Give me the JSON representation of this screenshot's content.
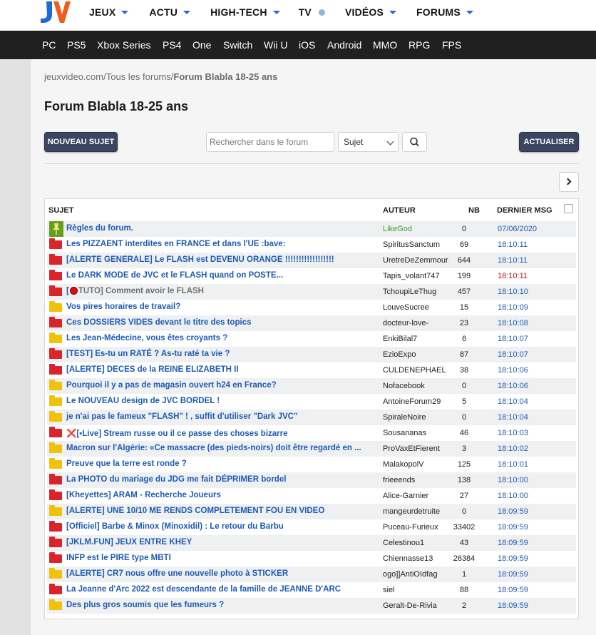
{
  "header": {
    "nav": [
      {
        "label": "JEUX",
        "marker": "caret"
      },
      {
        "label": "ACTU",
        "marker": "caret"
      },
      {
        "label": "HIGH-TECH",
        "marker": "caret"
      },
      {
        "label": "TV",
        "marker": "dot"
      },
      {
        "label": "VIDÉOS",
        "marker": "caret"
      },
      {
        "label": "FORUMS",
        "marker": "caret"
      }
    ]
  },
  "platforms": [
    "PC",
    "PS5",
    "Xbox Series",
    "PS4",
    "One",
    "Switch",
    "Wii U",
    "iOS",
    "Android",
    "MMO",
    "RPG",
    "FPS"
  ],
  "breadcrumb": {
    "site": "jeuxvideo.com",
    "sep1": "/",
    "forums": "Tous les forums",
    "sep2": "/",
    "current": "Forum Blabla 18-25 ans"
  },
  "page_title": "Forum Blabla 18-25 ans",
  "toolbar": {
    "new_topic": "NOUVEAU SUJET",
    "search_placeholder": "Rechercher dans le forum",
    "search_scope": "Sujet",
    "refresh": "ACTUALISER"
  },
  "table": {
    "headers": {
      "subject": "SUJET",
      "author": "AUTEUR",
      "count": "NB",
      "last": "DERNIER MSG"
    },
    "rows": [
      {
        "icon": "pin",
        "subject": "Règles du forum.",
        "author": "LikeGod",
        "author_color": "green",
        "nb": "0",
        "last": "07/06/2020",
        "last_color": "blue"
      },
      {
        "icon": "red",
        "subject": "Les PIZZAENT interdites en FRANCE et dans l'UE :bave:",
        "author": "SpiritusSanctum",
        "nb": "69",
        "last": "18:10:11",
        "last_color": "blue"
      },
      {
        "icon": "red",
        "subject": "[ALERTE GENERALE] Le FLASH est DEVENU ORANGE !!!!!!!!!!!!!!!!!!",
        "author": "UretreDeZemmour",
        "nb": "644",
        "last": "18:10:11",
        "last_color": "blue"
      },
      {
        "icon": "red",
        "subject": "Le DARK MODE de JVC et le FLASH quand on POSTE...",
        "author": "Tapis_volant747",
        "nb": "199",
        "last": "18:10:11",
        "last_color": "red"
      },
      {
        "icon": "red",
        "subject_prefix": "[",
        "subject": "TUTO] Comment avoir le FLASH",
        "dim": true,
        "dot": true,
        "author": "TchoupiLeThug",
        "nb": "457",
        "last": "18:10:10",
        "last_color": "blue"
      },
      {
        "icon": "yellow",
        "subject": "Vos pires horaires de travail?",
        "author": "LouveSucree",
        "nb": "15",
        "last": "18:10:09",
        "last_color": "blue"
      },
      {
        "icon": "red",
        "subject": "Ces DOSSIERS VIDES devant le titre des topics",
        "author": "docteur-love-",
        "nb": "23",
        "last": "18:10:08",
        "last_color": "blue"
      },
      {
        "icon": "yellow",
        "subject": "Les Jean-Médecine, vous êtes croyants ?",
        "author": "EnkiBilal7",
        "nb": "6",
        "last": "18:10:07",
        "last_color": "blue"
      },
      {
        "icon": "red",
        "subject": "[TEST] Es-tu un RATÉ ? As-tu raté ta vie ?",
        "author": "EzioExpo",
        "nb": "87",
        "last": "18:10:07",
        "last_color": "blue"
      },
      {
        "icon": "red",
        "subject": "[ALERTE] DECES de la REINE ELIZABETH II",
        "author": "CULDENEPHAEL",
        "nb": "38",
        "last": "18:10:06",
        "last_color": "blue"
      },
      {
        "icon": "yellow",
        "subject": "Pourquoi il y a pas de magasin ouvert h24 en France?",
        "author": "Nofacebook",
        "nb": "0",
        "last": "18:10:06",
        "last_color": "blue"
      },
      {
        "icon": "yellow",
        "subject": "Le NOUVEAU design de JVC BORDEL !",
        "author": "AntoineForum29",
        "nb": "5",
        "last": "18:10:04",
        "last_color": "blue"
      },
      {
        "icon": "yellow",
        "subject": "je n'ai pas le fameux \"FLASH\" ! , suffit d'utiliser \"Dark JVC\"",
        "author": "SpiraleNoire",
        "nb": "0",
        "last": "18:10:04",
        "last_color": "blue"
      },
      {
        "icon": "red",
        "subject_prefix": "❌",
        "subject": "[▪Live] Stream russe ou il ce passe des choses bizarre",
        "author": "Sousananas",
        "nb": "46",
        "last": "18:10:03",
        "last_color": "blue"
      },
      {
        "icon": "yellow",
        "subject": "Macron sur l'Algérie: «Ce massacre (des pieds-noirs) doit être regardé en ...",
        "author": "ProVaxEtFierent",
        "nb": "3",
        "last": "18:10:02",
        "last_color": "blue"
      },
      {
        "icon": "yellow",
        "subject": "Preuve que la terre est ronde ?",
        "author": "MalakopolV",
        "nb": "125",
        "last": "18:10:01",
        "last_color": "blue"
      },
      {
        "icon": "red",
        "subject": "La PHOTO du mariage du JDG me fait DÉPRIMER bordel",
        "author": "frieeends",
        "nb": "138",
        "last": "18:10:00",
        "last_color": "blue"
      },
      {
        "icon": "red",
        "subject": "[Kheyettes] ARAM - Recherche Joueurs",
        "author": "Alice-Garnier",
        "nb": "27",
        "last": "18:10:00",
        "last_color": "blue"
      },
      {
        "icon": "yellow",
        "subject": "[ALERTE] UNE 10/10 ME RENDS COMPLETEMENT FOU EN VIDEO",
        "author": "mangeurdetruite",
        "nb": "0",
        "last": "18:09:59",
        "last_color": "blue"
      },
      {
        "icon": "red",
        "subject": "[Officiel] Barbe & Minox (Minoxidil) : Le retour du Barbu",
        "author": "Puceau-Furieux",
        "nb": "33402",
        "last": "18:09:59",
        "last_color": "blue"
      },
      {
        "icon": "red",
        "subject": "[JKLM.FUN] JEUX ENTRE KHEY",
        "author": "Celestinou1",
        "nb": "43",
        "last": "18:09:59",
        "last_color": "blue"
      },
      {
        "icon": "red",
        "subject": "INFP est le PIRE type MBTI",
        "author": "Chiennasse13",
        "nb": "26384",
        "last": "18:09:59",
        "last_color": "blue"
      },
      {
        "icon": "yellow",
        "subject": "[ALERTE] CR7 nous offre une nouvelle photo à STICKER",
        "author": "ogo]]AntiOIdfag",
        "nb": "1",
        "last": "18:09:59",
        "last_color": "blue"
      },
      {
        "icon": "red",
        "subject": "La Jeanne d'Arc 2022 est descendante de la famille de JEANNE D'ARC",
        "author": "siel",
        "nb": "88",
        "last": "18:09:59",
        "last_color": "blue"
      },
      {
        "icon": "yellow",
        "subject": "Des plus gros soumis que les fumeurs ?",
        "author": "Geralt-De-Rivia",
        "nb": "2",
        "last": "18:09:59",
        "last_color": "blue"
      }
    ]
  },
  "colors": {
    "brand_blue": "#1e6bd6",
    "link_blue": "#1e5ab6",
    "button_dark": "#3c4661",
    "topic_red": "#d9242b",
    "topic_yellow": "#f0c20b",
    "pin_green": "#63a01e"
  }
}
